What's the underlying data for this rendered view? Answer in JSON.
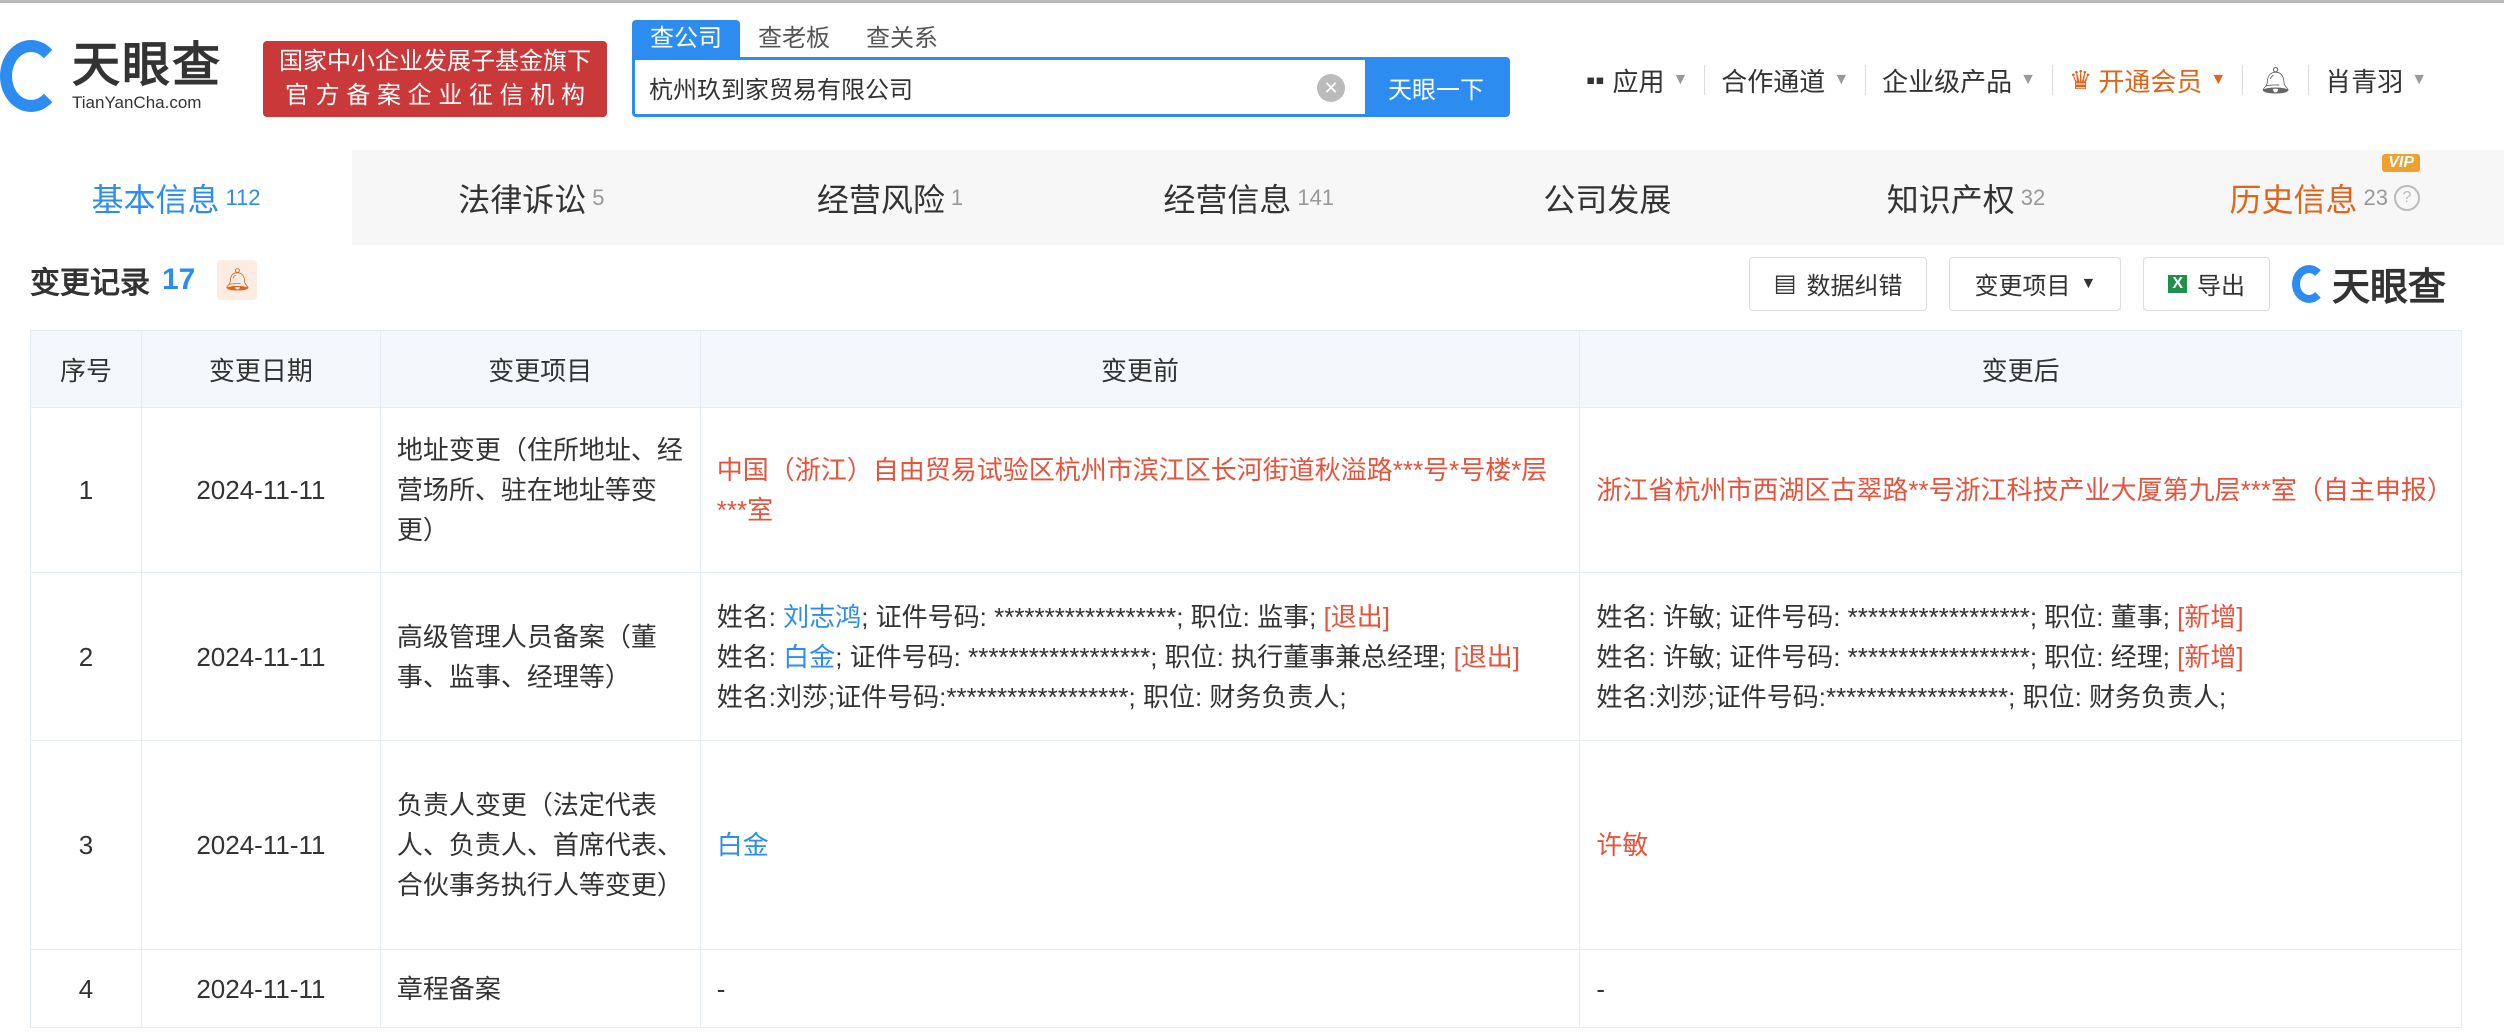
{
  "header": {
    "logo_cn": "天眼查",
    "logo_en": "TianYanCha.com",
    "badge_line1": "国家中小企业发展子基金旗下",
    "badge_line2": "官 方 备 案 企 业 征 信 机 构",
    "search_tabs": [
      "查公司",
      "查老板",
      "查关系"
    ],
    "search_value": "杭州玖到家贸易有限公司",
    "search_button": "天眼一下",
    "nav": {
      "apps": "应用",
      "partner": "合作通道",
      "enterprise": "企业级产品",
      "vip": "开通会员",
      "user": "肖青羽"
    }
  },
  "tabs": [
    {
      "label": "基本信息",
      "count": "112"
    },
    {
      "label": "法律诉讼",
      "count": "5"
    },
    {
      "label": "经营风险",
      "count": "1"
    },
    {
      "label": "经营信息",
      "count": "141"
    },
    {
      "label": "公司发展",
      "count": ""
    },
    {
      "label": "知识产权",
      "count": "32"
    },
    {
      "label": "历史信息",
      "count": "23",
      "badge": "VIP"
    }
  ],
  "section": {
    "title": "变更记录",
    "count": "17",
    "report_btn": "数据纠错",
    "filter_btn": "变更项目",
    "export_btn": "导出",
    "brand": "天眼查"
  },
  "table": {
    "headers": [
      "序号",
      "变更日期",
      "变更项目",
      "变更前",
      "变更后"
    ],
    "rows": [
      {
        "no": "1",
        "date": "2024-11-11",
        "item": "地址变更（住所地址、经营场所、驻在地址等变更）",
        "before": "中国（浙江）自由贸易试验区杭州市滨江区长河街道秋溢路***号*号楼*层***室",
        "after": "浙江省杭州市西湖区古翠路**号浙江科技产业大厦第九层***室（自主申报）"
      },
      {
        "no": "2",
        "date": "2024-11-11",
        "item": "高级管理人员备案（董事、监事、经理等）",
        "before": [
          {
            "pre": "姓名: ",
            "name": "刘志鸿",
            "mid": "; 证件号码: ******************; 职位: 监事; ",
            "tag": "[退出]"
          },
          {
            "pre": "姓名: ",
            "name": "白金",
            "mid": "; 证件号码: ******************; 职位: 执行董事兼总经理; ",
            "tag": "[退出]"
          },
          {
            "pre": "姓名:刘莎;证件号码:******************; 职位: 财务负责人;",
            "name": "",
            "mid": "",
            "tag": ""
          }
        ],
        "after": [
          {
            "pre": "姓名: 许敏; 证件号码: ******************; 职位: 董事; ",
            "tag": "[新增]"
          },
          {
            "pre": "姓名: 许敏; 证件号码: ******************; 职位: 经理; ",
            "tag": "[新增]"
          },
          {
            "pre": "姓名:刘莎;证件号码:******************; 职位: 财务负责人;",
            "tag": ""
          }
        ]
      },
      {
        "no": "3",
        "date": "2024-11-11",
        "item": "负责人变更（法定代表人、负责人、首席代表、合伙事务执行人等变更）",
        "before": "白金",
        "after": "许敏"
      },
      {
        "no": "4",
        "date": "2024-11-11",
        "item": "章程备案",
        "before": "-",
        "after": "-"
      }
    ]
  }
}
